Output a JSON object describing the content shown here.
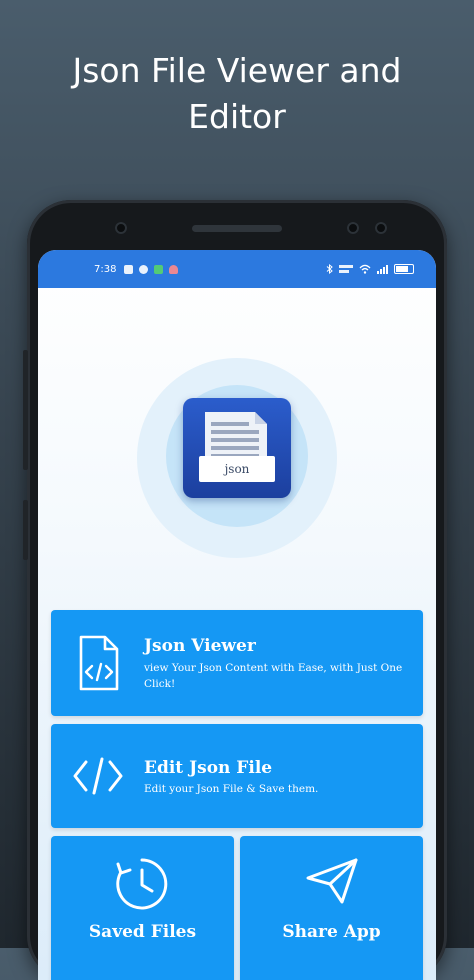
{
  "headline": {
    "line1": "Json File Viewer and",
    "line2": "Editor"
  },
  "status_bar": {
    "time": "7:38"
  },
  "app_logo": {
    "file_label": "json"
  },
  "menu": {
    "json_viewer": {
      "title": "Json Viewer",
      "description": "view Your Json Content with Ease, with Just One Click!",
      "icon": "file-code-icon"
    },
    "edit_json": {
      "title": "Edit Json File",
      "description": "Edit your Json File & Save them.",
      "icon": "code-brackets-icon"
    },
    "saved_files": {
      "title": "Saved Files",
      "icon": "clock-history-icon"
    },
    "share_app": {
      "title": "Share App",
      "icon": "send-icon"
    }
  },
  "colors": {
    "status_bar": "#2c79df",
    "card": "#1598f4",
    "logo": "#2455c0"
  }
}
